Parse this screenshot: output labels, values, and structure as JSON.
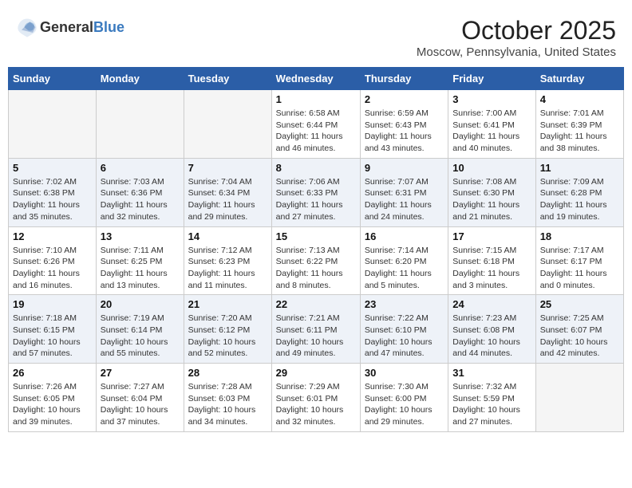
{
  "header": {
    "logo_general": "General",
    "logo_blue": "Blue",
    "month": "October 2025",
    "location": "Moscow, Pennsylvania, United States"
  },
  "weekdays": [
    "Sunday",
    "Monday",
    "Tuesday",
    "Wednesday",
    "Thursday",
    "Friday",
    "Saturday"
  ],
  "weeks": [
    [
      {
        "day": "",
        "empty": true
      },
      {
        "day": "",
        "empty": true
      },
      {
        "day": "",
        "empty": true
      },
      {
        "day": "1",
        "info": "Sunrise: 6:58 AM\nSunset: 6:44 PM\nDaylight: 11 hours\nand 46 minutes."
      },
      {
        "day": "2",
        "info": "Sunrise: 6:59 AM\nSunset: 6:43 PM\nDaylight: 11 hours\nand 43 minutes."
      },
      {
        "day": "3",
        "info": "Sunrise: 7:00 AM\nSunset: 6:41 PM\nDaylight: 11 hours\nand 40 minutes."
      },
      {
        "day": "4",
        "info": "Sunrise: 7:01 AM\nSunset: 6:39 PM\nDaylight: 11 hours\nand 38 minutes."
      }
    ],
    [
      {
        "day": "5",
        "info": "Sunrise: 7:02 AM\nSunset: 6:38 PM\nDaylight: 11 hours\nand 35 minutes."
      },
      {
        "day": "6",
        "info": "Sunrise: 7:03 AM\nSunset: 6:36 PM\nDaylight: 11 hours\nand 32 minutes."
      },
      {
        "day": "7",
        "info": "Sunrise: 7:04 AM\nSunset: 6:34 PM\nDaylight: 11 hours\nand 29 minutes."
      },
      {
        "day": "8",
        "info": "Sunrise: 7:06 AM\nSunset: 6:33 PM\nDaylight: 11 hours\nand 27 minutes."
      },
      {
        "day": "9",
        "info": "Sunrise: 7:07 AM\nSunset: 6:31 PM\nDaylight: 11 hours\nand 24 minutes."
      },
      {
        "day": "10",
        "info": "Sunrise: 7:08 AM\nSunset: 6:30 PM\nDaylight: 11 hours\nand 21 minutes."
      },
      {
        "day": "11",
        "info": "Sunrise: 7:09 AM\nSunset: 6:28 PM\nDaylight: 11 hours\nand 19 minutes."
      }
    ],
    [
      {
        "day": "12",
        "info": "Sunrise: 7:10 AM\nSunset: 6:26 PM\nDaylight: 11 hours\nand 16 minutes."
      },
      {
        "day": "13",
        "info": "Sunrise: 7:11 AM\nSunset: 6:25 PM\nDaylight: 11 hours\nand 13 minutes."
      },
      {
        "day": "14",
        "info": "Sunrise: 7:12 AM\nSunset: 6:23 PM\nDaylight: 11 hours\nand 11 minutes."
      },
      {
        "day": "15",
        "info": "Sunrise: 7:13 AM\nSunset: 6:22 PM\nDaylight: 11 hours\nand 8 minutes."
      },
      {
        "day": "16",
        "info": "Sunrise: 7:14 AM\nSunset: 6:20 PM\nDaylight: 11 hours\nand 5 minutes."
      },
      {
        "day": "17",
        "info": "Sunrise: 7:15 AM\nSunset: 6:18 PM\nDaylight: 11 hours\nand 3 minutes."
      },
      {
        "day": "18",
        "info": "Sunrise: 7:17 AM\nSunset: 6:17 PM\nDaylight: 11 hours\nand 0 minutes."
      }
    ],
    [
      {
        "day": "19",
        "info": "Sunrise: 7:18 AM\nSunset: 6:15 PM\nDaylight: 10 hours\nand 57 minutes."
      },
      {
        "day": "20",
        "info": "Sunrise: 7:19 AM\nSunset: 6:14 PM\nDaylight: 10 hours\nand 55 minutes."
      },
      {
        "day": "21",
        "info": "Sunrise: 7:20 AM\nSunset: 6:12 PM\nDaylight: 10 hours\nand 52 minutes."
      },
      {
        "day": "22",
        "info": "Sunrise: 7:21 AM\nSunset: 6:11 PM\nDaylight: 10 hours\nand 49 minutes."
      },
      {
        "day": "23",
        "info": "Sunrise: 7:22 AM\nSunset: 6:10 PM\nDaylight: 10 hours\nand 47 minutes."
      },
      {
        "day": "24",
        "info": "Sunrise: 7:23 AM\nSunset: 6:08 PM\nDaylight: 10 hours\nand 44 minutes."
      },
      {
        "day": "25",
        "info": "Sunrise: 7:25 AM\nSunset: 6:07 PM\nDaylight: 10 hours\nand 42 minutes."
      }
    ],
    [
      {
        "day": "26",
        "info": "Sunrise: 7:26 AM\nSunset: 6:05 PM\nDaylight: 10 hours\nand 39 minutes."
      },
      {
        "day": "27",
        "info": "Sunrise: 7:27 AM\nSunset: 6:04 PM\nDaylight: 10 hours\nand 37 minutes."
      },
      {
        "day": "28",
        "info": "Sunrise: 7:28 AM\nSunset: 6:03 PM\nDaylight: 10 hours\nand 34 minutes."
      },
      {
        "day": "29",
        "info": "Sunrise: 7:29 AM\nSunset: 6:01 PM\nDaylight: 10 hours\nand 32 minutes."
      },
      {
        "day": "30",
        "info": "Sunrise: 7:30 AM\nSunset: 6:00 PM\nDaylight: 10 hours\nand 29 minutes."
      },
      {
        "day": "31",
        "info": "Sunrise: 7:32 AM\nSunset: 5:59 PM\nDaylight: 10 hours\nand 27 minutes."
      },
      {
        "day": "",
        "empty": true
      }
    ]
  ]
}
